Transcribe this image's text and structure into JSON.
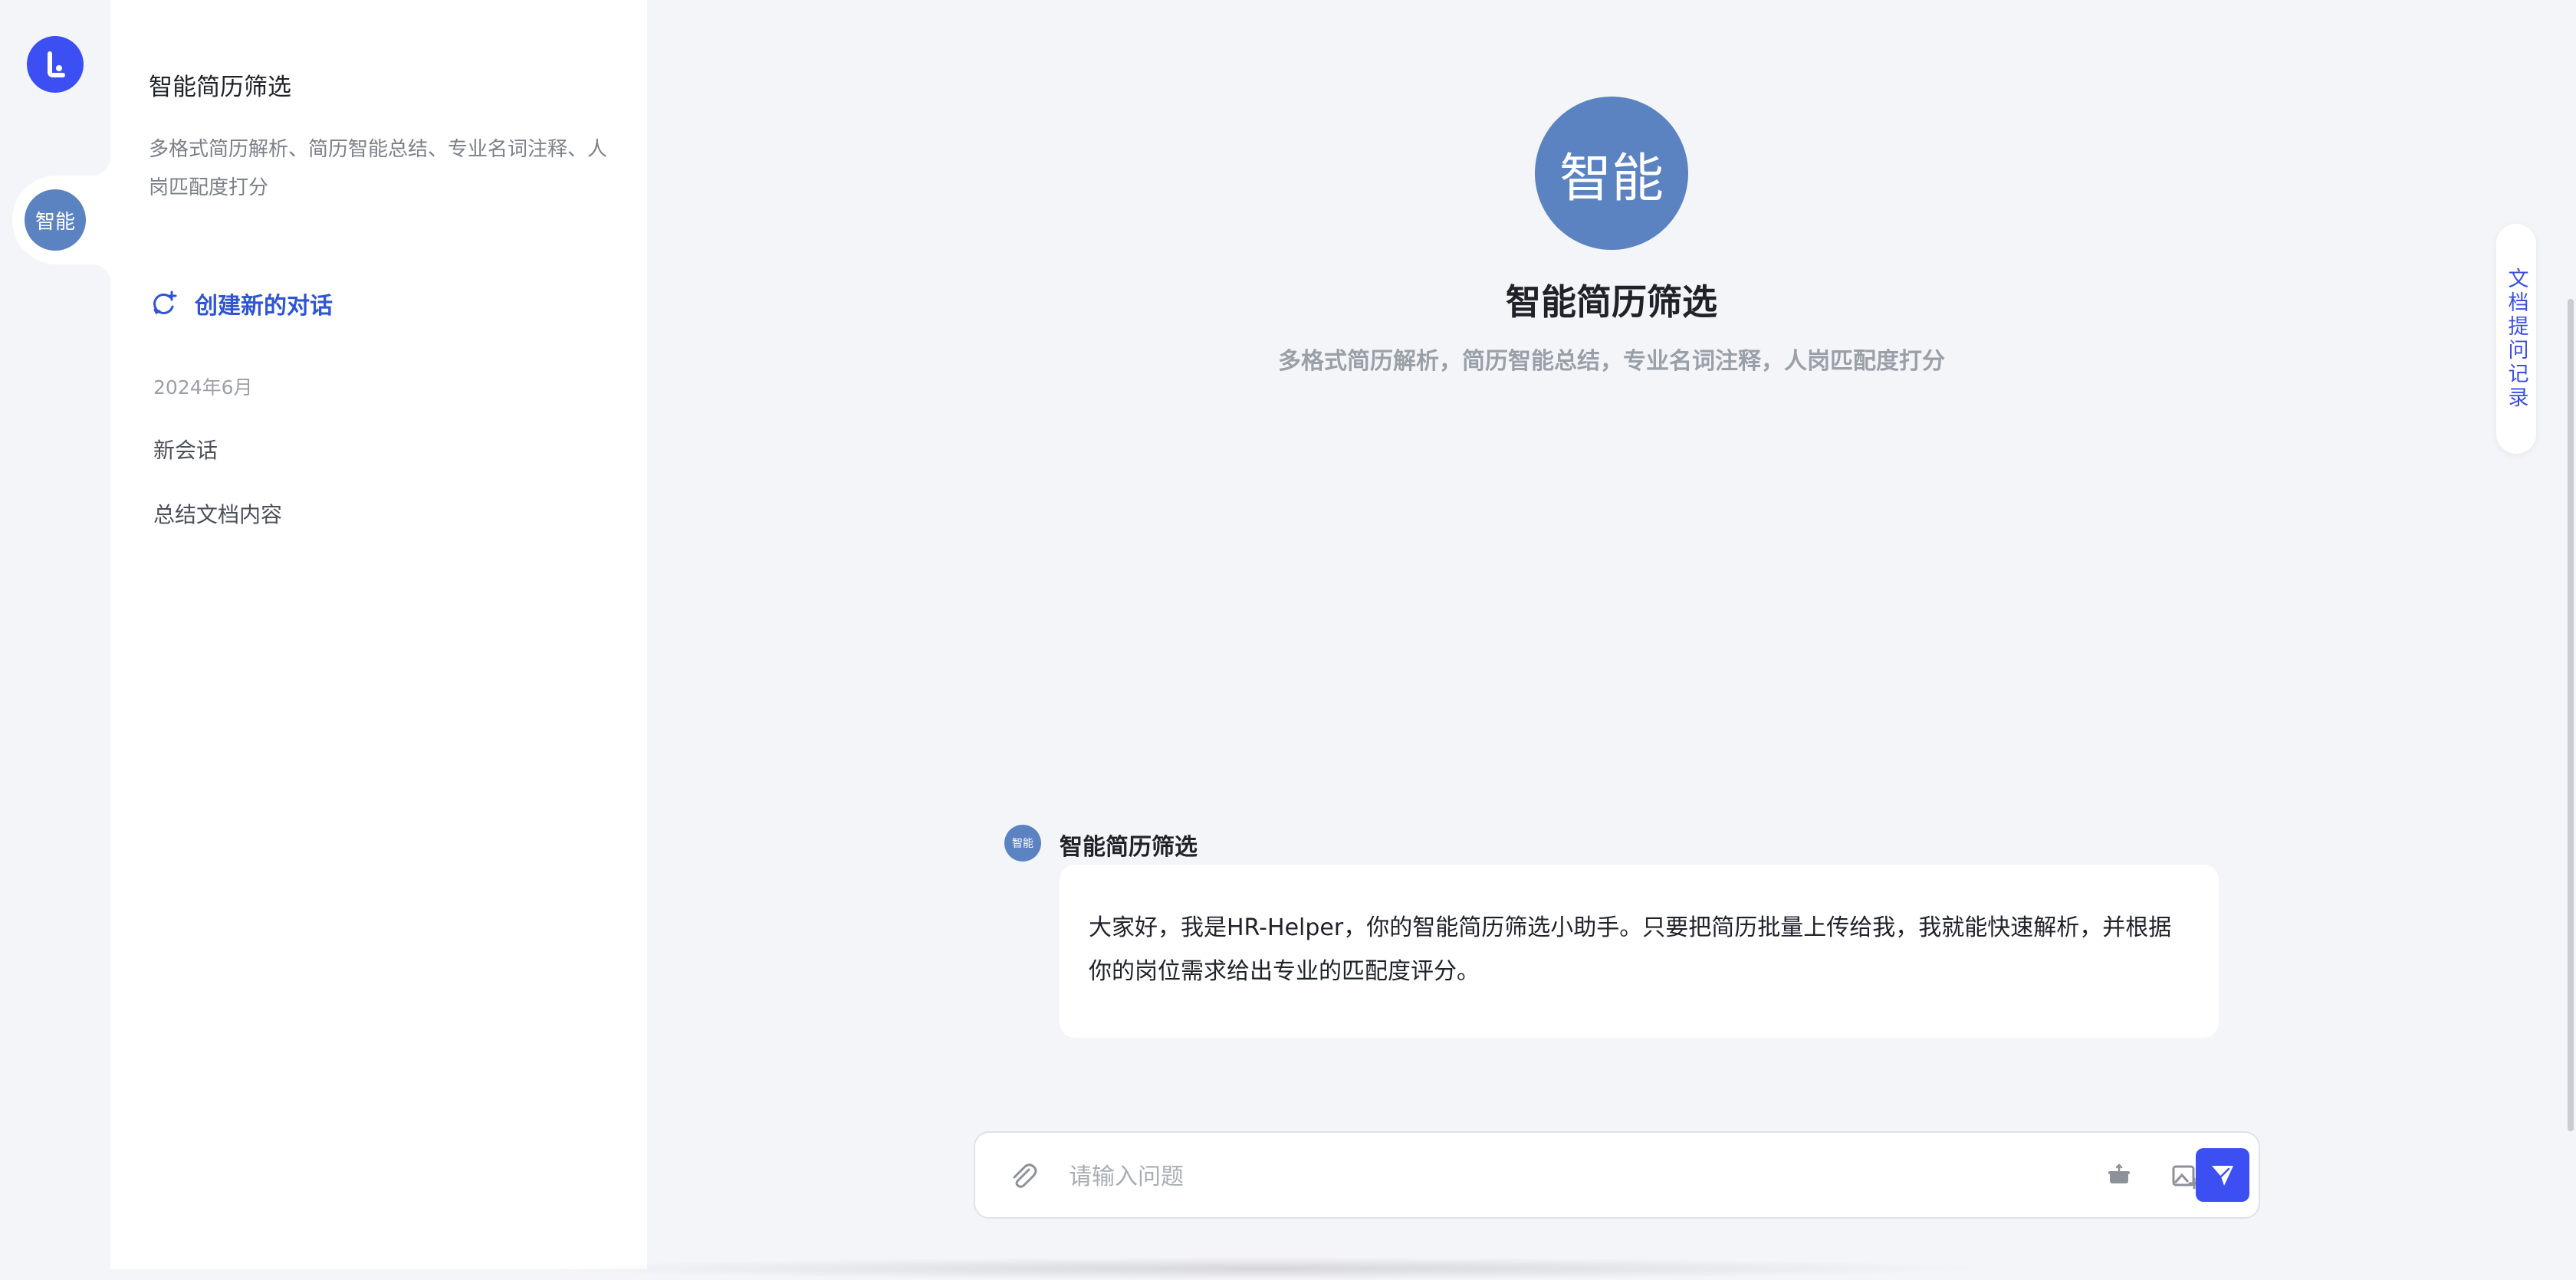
{
  "rail": {
    "avatar_label": "智能"
  },
  "sidebar": {
    "title": "智能简历筛选",
    "description": "多格式简历解析、简历智能总结、专业名词注释、人岗匹配度打分",
    "new_chat_label": "创建新的对话",
    "month": "2024年6月",
    "history": [
      {
        "label": "新会话"
      },
      {
        "label": "总结文档内容"
      }
    ]
  },
  "main": {
    "hero_avatar_label": "智能",
    "title": "智能简历筛选",
    "subtitle": "多格式简历解析，简历智能总结，专业名词注释，人岗匹配度打分",
    "message": {
      "avatar_label": "智能",
      "sender": "智能简历筛选",
      "text": "大家好，我是HR-Helper，你的智能简历筛选小助手。只要把简历批量上传给我，我就能快速解析，并根据你的岗位需求给出专业的匹配度评分。"
    },
    "doc_history_label": "文档提问记录",
    "input": {
      "placeholder": "请输入问题",
      "value": ""
    }
  },
  "colors": {
    "accent": "#3c4ff2",
    "avatar": "#5b83c2",
    "link": "#2f55d4"
  },
  "icons": [
    "logo-icon",
    "new-chat-icon",
    "attach-icon",
    "cup-icon",
    "image-add-icon",
    "send-icon"
  ]
}
